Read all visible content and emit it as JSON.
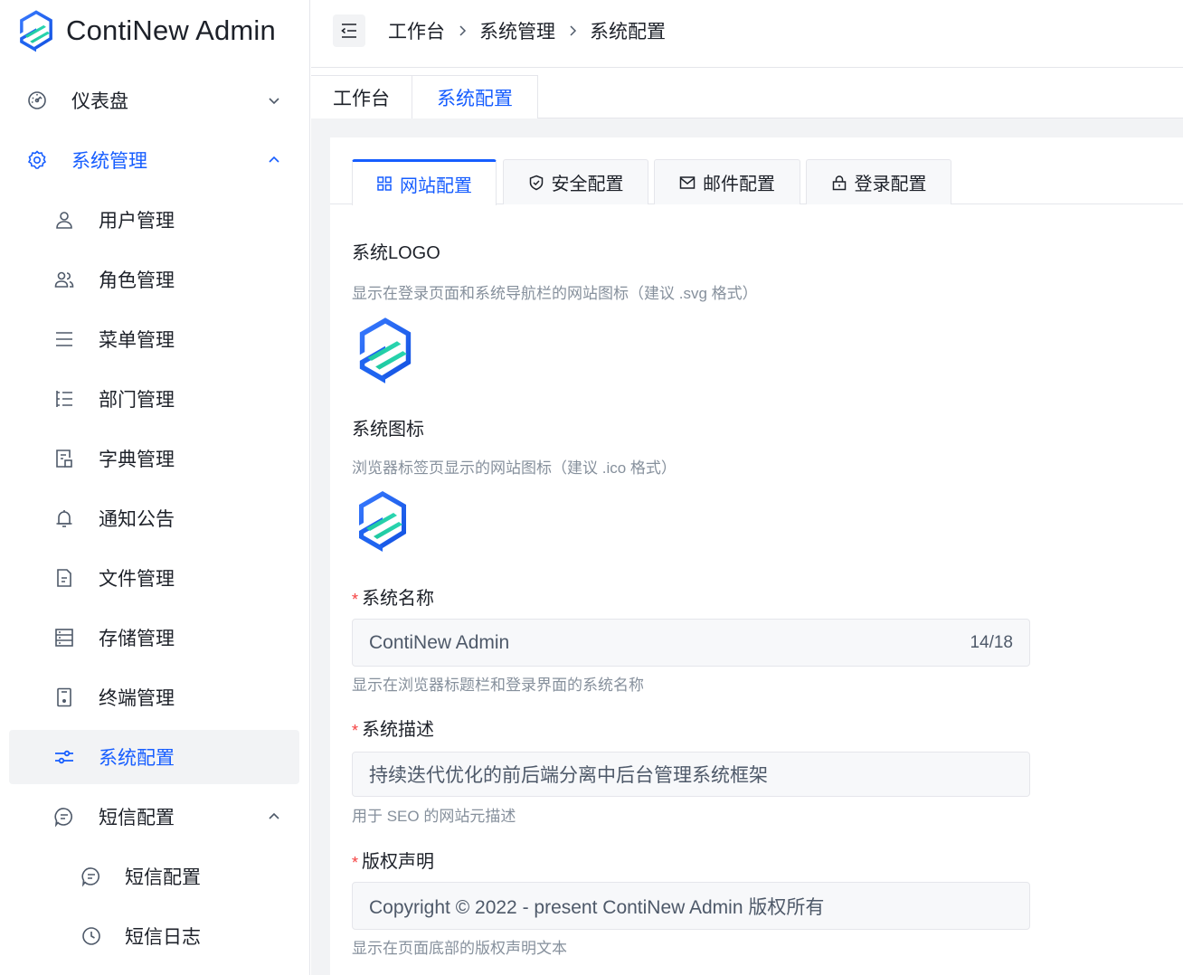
{
  "app": {
    "name": "ContiNew Admin",
    "accent_color": "#165dff"
  },
  "sidebar": {
    "items": [
      {
        "label": "仪表盘",
        "icon": "dashboard-icon",
        "expanded": false
      },
      {
        "label": "系统管理",
        "icon": "gear-icon",
        "expanded": true
      },
      {
        "label": "用户管理",
        "icon": "user-icon"
      },
      {
        "label": "角色管理",
        "icon": "user-group-icon"
      },
      {
        "label": "菜单管理",
        "icon": "menu-list-icon"
      },
      {
        "label": "部门管理",
        "icon": "tree-list-icon"
      },
      {
        "label": "字典管理",
        "icon": "dictionary-icon"
      },
      {
        "label": "通知公告",
        "icon": "bell-icon"
      },
      {
        "label": "文件管理",
        "icon": "file-icon"
      },
      {
        "label": "存储管理",
        "icon": "storage-icon"
      },
      {
        "label": "终端管理",
        "icon": "terminal-device-icon"
      },
      {
        "label": "系统配置",
        "icon": "sliders-icon",
        "active": true
      },
      {
        "label": "短信配置",
        "icon": "message-icon",
        "expanded": true
      },
      {
        "label": "短信配置",
        "icon": "message-icon"
      },
      {
        "label": "短信日志",
        "icon": "history-icon"
      }
    ]
  },
  "header": {
    "breadcrumb": [
      "工作台",
      "系统管理",
      "系统配置"
    ]
  },
  "page_tabs": [
    {
      "label": "工作台",
      "active": false
    },
    {
      "label": "系统配置",
      "active": true
    }
  ],
  "config_tabs": [
    {
      "label": "网站配置",
      "icon": "grid-icon",
      "active": true
    },
    {
      "label": "安全配置",
      "icon": "shield-icon",
      "active": false
    },
    {
      "label": "邮件配置",
      "icon": "mail-icon",
      "active": false
    },
    {
      "label": "登录配置",
      "icon": "lock-icon",
      "active": false
    }
  ],
  "form": {
    "logo": {
      "title": "系统LOGO",
      "hint": "显示在登录页面和系统导航栏的网站图标（建议 .svg 格式）"
    },
    "favicon": {
      "title": "系统图标",
      "hint": "浏览器标签页显示的网站图标（建议 .ico 格式）"
    },
    "name": {
      "required_mark": "*",
      "title": "系统名称",
      "value": "ContiNew Admin",
      "count": "14/18",
      "hint": "显示在浏览器标题栏和登录界面的系统名称"
    },
    "description": {
      "required_mark": "*",
      "title": "系统描述",
      "value": "持续迭代优化的前后端分离中后台管理系统框架",
      "hint": "用于 SEO 的网站元描述"
    },
    "copyright": {
      "required_mark": "*",
      "title": "版权声明",
      "value": "Copyright © 2022 - present ContiNew Admin 版权所有",
      "hint": "显示在页面底部的版权声明文本"
    }
  }
}
